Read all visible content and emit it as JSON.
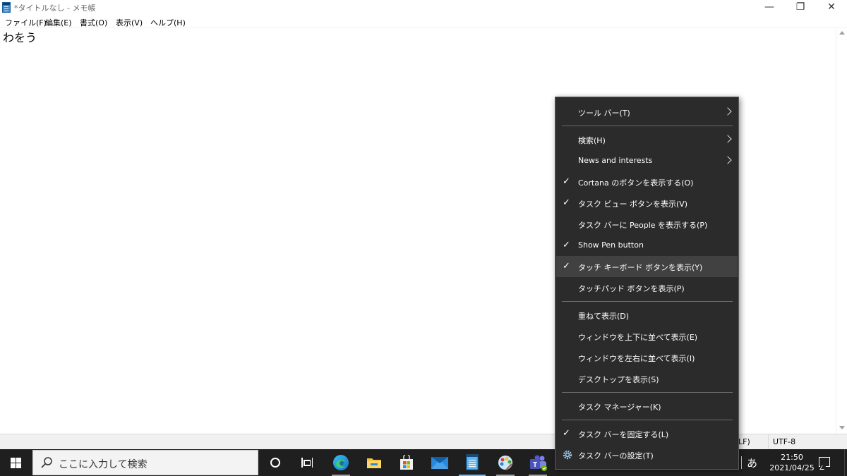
{
  "window": {
    "title": "*タイトルなし - メモ帳",
    "minimize": "—",
    "restore": "❐",
    "close": "✕"
  },
  "menubar": {
    "file": "ファイル(F)",
    "edit": "編集(E)",
    "format": "書式(O)",
    "view": "表示(V)",
    "help": "ヘルプ(H)"
  },
  "editor": {
    "content": "わをう"
  },
  "statusbar": {
    "line_ending": "LF)",
    "encoding": "UTF-8"
  },
  "context_menu": {
    "items": [
      {
        "label": "ツール バー(T)",
        "checked": false,
        "submenu": true
      },
      {
        "label": "検索(H)",
        "checked": false,
        "submenu": true
      },
      {
        "label": "News and interests",
        "checked": false,
        "submenu": true
      },
      {
        "label": "Cortana のボタンを表示する(O)",
        "checked": true,
        "submenu": false
      },
      {
        "label": "タスク ビュー ボタンを表示(V)",
        "checked": true,
        "submenu": false
      },
      {
        "label": "タスク バーに People を表示する(P)",
        "checked": false,
        "submenu": false
      },
      {
        "label": "Show Pen button",
        "checked": true,
        "submenu": false
      },
      {
        "label": "タッチ キーボード ボタンを表示(Y)",
        "checked": true,
        "submenu": false,
        "highlighted": true
      },
      {
        "label": "タッチパッド ボタンを表示(P)",
        "checked": false,
        "submenu": false
      },
      {
        "label": "重ねて表示(D)",
        "checked": false,
        "submenu": false
      },
      {
        "label": "ウィンドウを上下に並べて表示(E)",
        "checked": false,
        "submenu": false
      },
      {
        "label": "ウィンドウを左右に並べて表示(I)",
        "checked": false,
        "submenu": false
      },
      {
        "label": "デスクトップを表示(S)",
        "checked": false,
        "submenu": false
      },
      {
        "label": "タスク マネージャー(K)",
        "checked": false,
        "submenu": false
      },
      {
        "label": "タスク バーを固定する(L)",
        "checked": true,
        "submenu": false
      },
      {
        "label": "タスク バーの設定(T)",
        "checked": false,
        "submenu": false,
        "icon": "gear-icon"
      }
    ],
    "check_glyph": "✓"
  },
  "taskbar": {
    "search_placeholder": "ここに入力して検索",
    "apps": [
      "cortana-icon",
      "task-view-icon",
      "edge-icon",
      "file-explorer-icon",
      "store-icon",
      "mail-icon",
      "notepad-icon",
      "paint-icon",
      "teams-icon"
    ],
    "ime_mode": "あ",
    "time": "21:50",
    "date": "2021/04/25"
  },
  "colors": {
    "taskbar_bg": "#1f1f1f",
    "menu_bg": "#2b2b2b",
    "menu_highlight": "#414141",
    "accent": "#76b9ed"
  }
}
